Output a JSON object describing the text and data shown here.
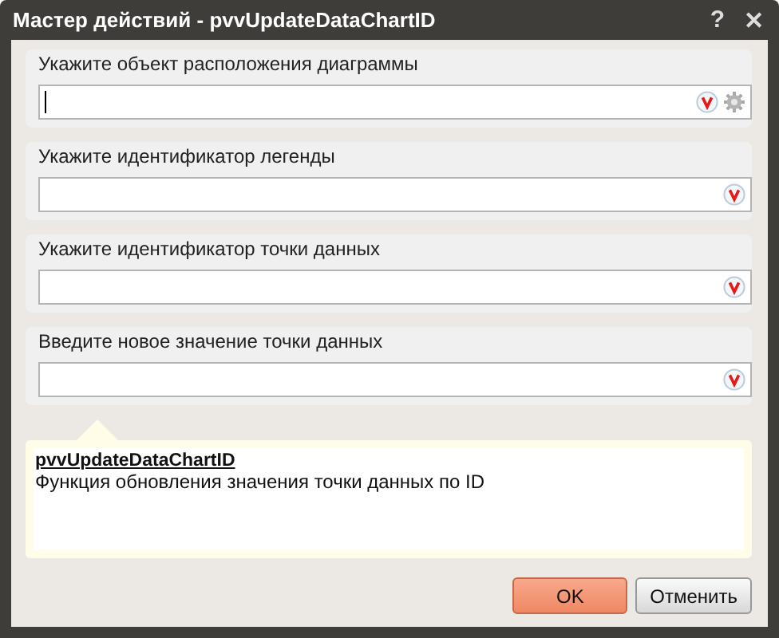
{
  "window": {
    "title": "Мастер действий - pvvUpdateDataChartID",
    "help": "?",
    "close": "✕"
  },
  "fields": [
    {
      "label": "Укажите объект расположения диаграммы",
      "focused": true,
      "settings": true
    },
    {
      "label": "Укажите идентификатор легенды",
      "focused": false,
      "settings": false
    },
    {
      "label": "Укажите идентификатор точки данных",
      "focused": false,
      "settings": false
    },
    {
      "label": "Введите новое значение точки данных",
      "focused": false,
      "settings": false
    }
  ],
  "info": {
    "title": "pvvUpdateDataChartID",
    "description": "Функция обновления значения точки данных по ID"
  },
  "buttons": [
    {
      "label": "OK",
      "kind": "primary"
    },
    {
      "label": "Отменить",
      "kind": "default"
    }
  ]
}
